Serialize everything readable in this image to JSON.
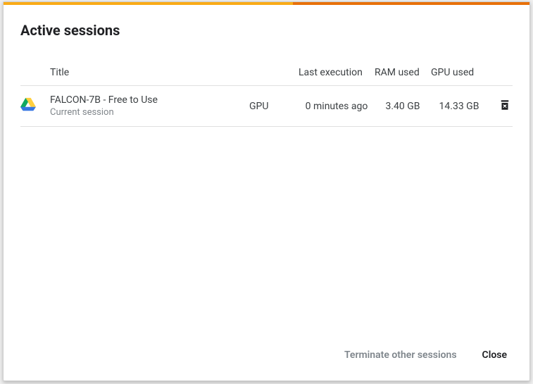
{
  "dialog": {
    "title": "Active sessions"
  },
  "table": {
    "headers": {
      "title": "Title",
      "last_execution": "Last execution",
      "ram_used": "RAM used",
      "gpu_used": "GPU used"
    }
  },
  "sessions": [
    {
      "icon": "drive-icon",
      "title": "FALCON-7B - Free to Use",
      "subtitle": "Current session",
      "hardware": "GPU",
      "last_execution": "0 minutes ago",
      "ram_used": "3.40 GB",
      "gpu_used": "14.33 GB"
    }
  ],
  "footer": {
    "terminate_label": "Terminate other sessions",
    "close_label": "Close"
  }
}
